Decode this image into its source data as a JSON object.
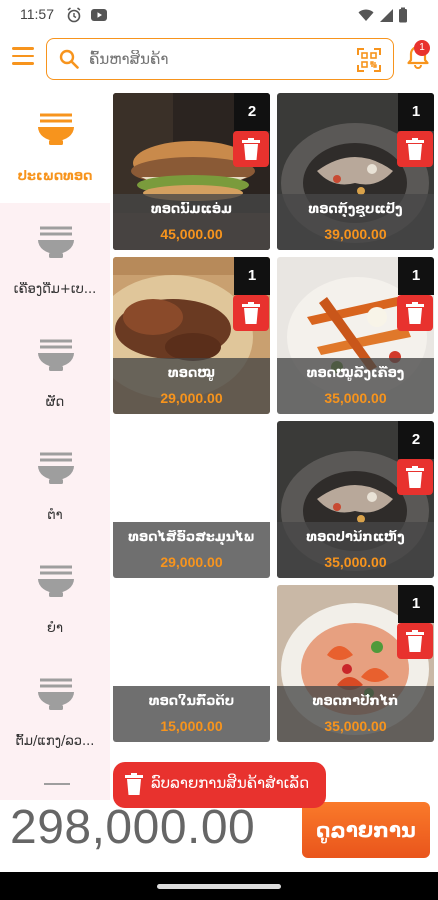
{
  "status_bar": {
    "time": "11:57"
  },
  "header": {
    "search_placeholder": "ຄົ້ນຫາສິນຄ້າ",
    "notification_count": "1"
  },
  "sidebar": {
    "items": [
      {
        "label": "ປະເພດທອດ",
        "active": true
      },
      {
        "label": "ເຄື່ອງດື່ມ+ເບ...",
        "active": false
      },
      {
        "label": "ຜັດ",
        "active": false
      },
      {
        "label": "ຕຳ",
        "active": false
      },
      {
        "label": "ຍຳ",
        "active": false
      },
      {
        "label": "ຕົ້ມ/ແກງ/ລວ...",
        "active": false
      }
    ]
  },
  "products": [
    {
      "name": "ທອດນົມແອ່ມ",
      "price": "45,000.00",
      "qty": "2",
      "image": "burger-sandwich"
    },
    {
      "name": "ທອດກຸ້ງຊຸບແປ້ງ",
      "price": "39,000.00",
      "qty": "1",
      "image": "fried-shrimp-bowl"
    },
    {
      "name": "ທອດໝູ",
      "price": "29,000.00",
      "qty": "1",
      "image": "fried-pork-rice"
    },
    {
      "name": "ທອດໝູລີ້ງເຄື່ອງ",
      "price": "35,000.00",
      "qty": "1",
      "image": "fried-pork-fries"
    },
    {
      "name": "ທອດໄສ້ອົ່ວສະມຸນໄພ",
      "price": "29,000.00",
      "qty": "",
      "image": "none"
    },
    {
      "name": "ທອດປານິກແຫ້ງ",
      "price": "35,000.00",
      "qty": "2",
      "image": "fried-shrimp-bowl"
    },
    {
      "name": "ທອດໃນກົ້ວດິບ",
      "price": "15,000.00",
      "qty": "",
      "image": "none"
    },
    {
      "name": "ທອດກາປີກໄກ່",
      "price": "35,000.00",
      "qty": "1",
      "image": "shrimp-salad"
    }
  ],
  "toast": {
    "message": "ລົບລາຍການສິນຄ້າສຳເລັດ"
  },
  "footer": {
    "total": "298,000.00",
    "view_button": "ດູລາຍການ"
  },
  "colors": {
    "accent": "#f7941d",
    "danger": "#e8322e",
    "sidebar_bg": "#fdf1f3",
    "button": "#ec5f20"
  }
}
